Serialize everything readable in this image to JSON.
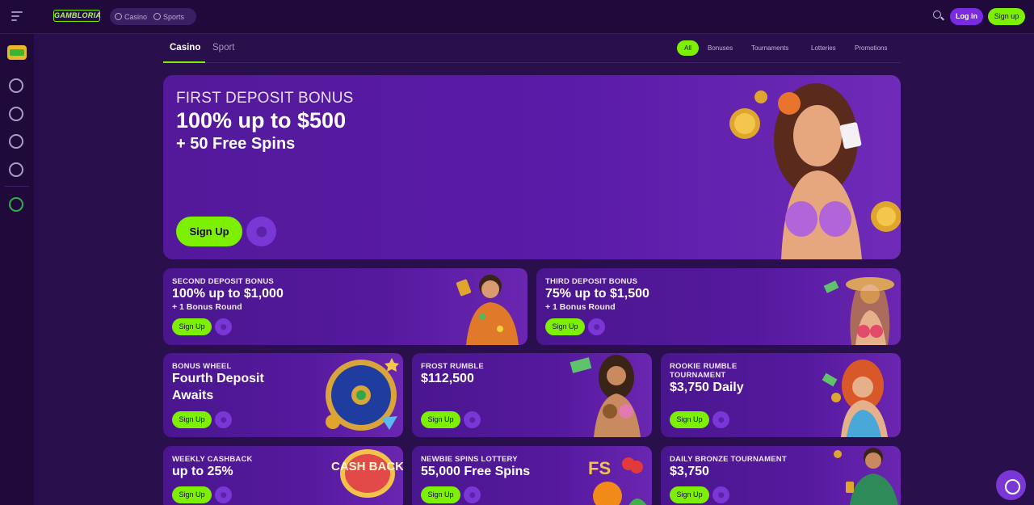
{
  "header": {
    "logo_text": "GAMBLORIA",
    "switch": {
      "casino": "Casino",
      "sports": "Sports"
    },
    "login_label": "Log in",
    "signup_label": "Sign up"
  },
  "tabs": {
    "casino": "Casino",
    "sport": "Sport",
    "filters": [
      "All",
      "Bonuses",
      "Tournaments",
      "Lotteries",
      "Promotions"
    ]
  },
  "hero": {
    "subtitle": "FIRST DEPOSIT BONUS",
    "title": "100% up to  $500",
    "line3": "+ 50 Free Spins",
    "signup_label": "Sign Up"
  },
  "cards": [
    {
      "title": "SECOND DEPOSIT BONUS",
      "big": "100% up to  $1,000",
      "small": "+ 1 Bonus Round",
      "signup": "Sign Up"
    },
    {
      "title": "THIRD DEPOSIT BONUS",
      "big": "75% up to  $1,500",
      "small": "+ 1 Bonus Round",
      "signup": "Sign Up"
    },
    {
      "title": "BONUS WHEEL",
      "big": "Fourth Deposit Awaits",
      "signup": "Sign Up"
    },
    {
      "title": "FROST RUMBLE",
      "big": "$112,500",
      "signup": "Sign Up"
    },
    {
      "title": "ROOKIE RUMBLE TOURNAMENT",
      "big": "$3,750 Daily",
      "signup": "Sign Up"
    },
    {
      "title": "WEEKLY CASHBACK",
      "big": "up to 25%",
      "signup": "Sign Up",
      "art_text": "CASH BACK"
    },
    {
      "title": "NEWBIE SPINS LOTTERY",
      "big": "55,000 Free Spins",
      "signup": "Sign Up",
      "art_text": "FS"
    },
    {
      "title": "DAILY BRONZE TOURNAMENT",
      "big": "$3,750",
      "signup": "Sign Up"
    }
  ],
  "colors": {
    "accent": "#7cf000",
    "purple": "#7b36d6",
    "background": "#2a0f4d"
  },
  "icons": [
    "menu-icon",
    "casino-icon",
    "sports-icon",
    "search-icon",
    "slot-machine-icon",
    "football-icon",
    "live-icon",
    "volleyball-icon",
    "rugby-icon",
    "globe-icon",
    "info-icon",
    "support-icon"
  ]
}
